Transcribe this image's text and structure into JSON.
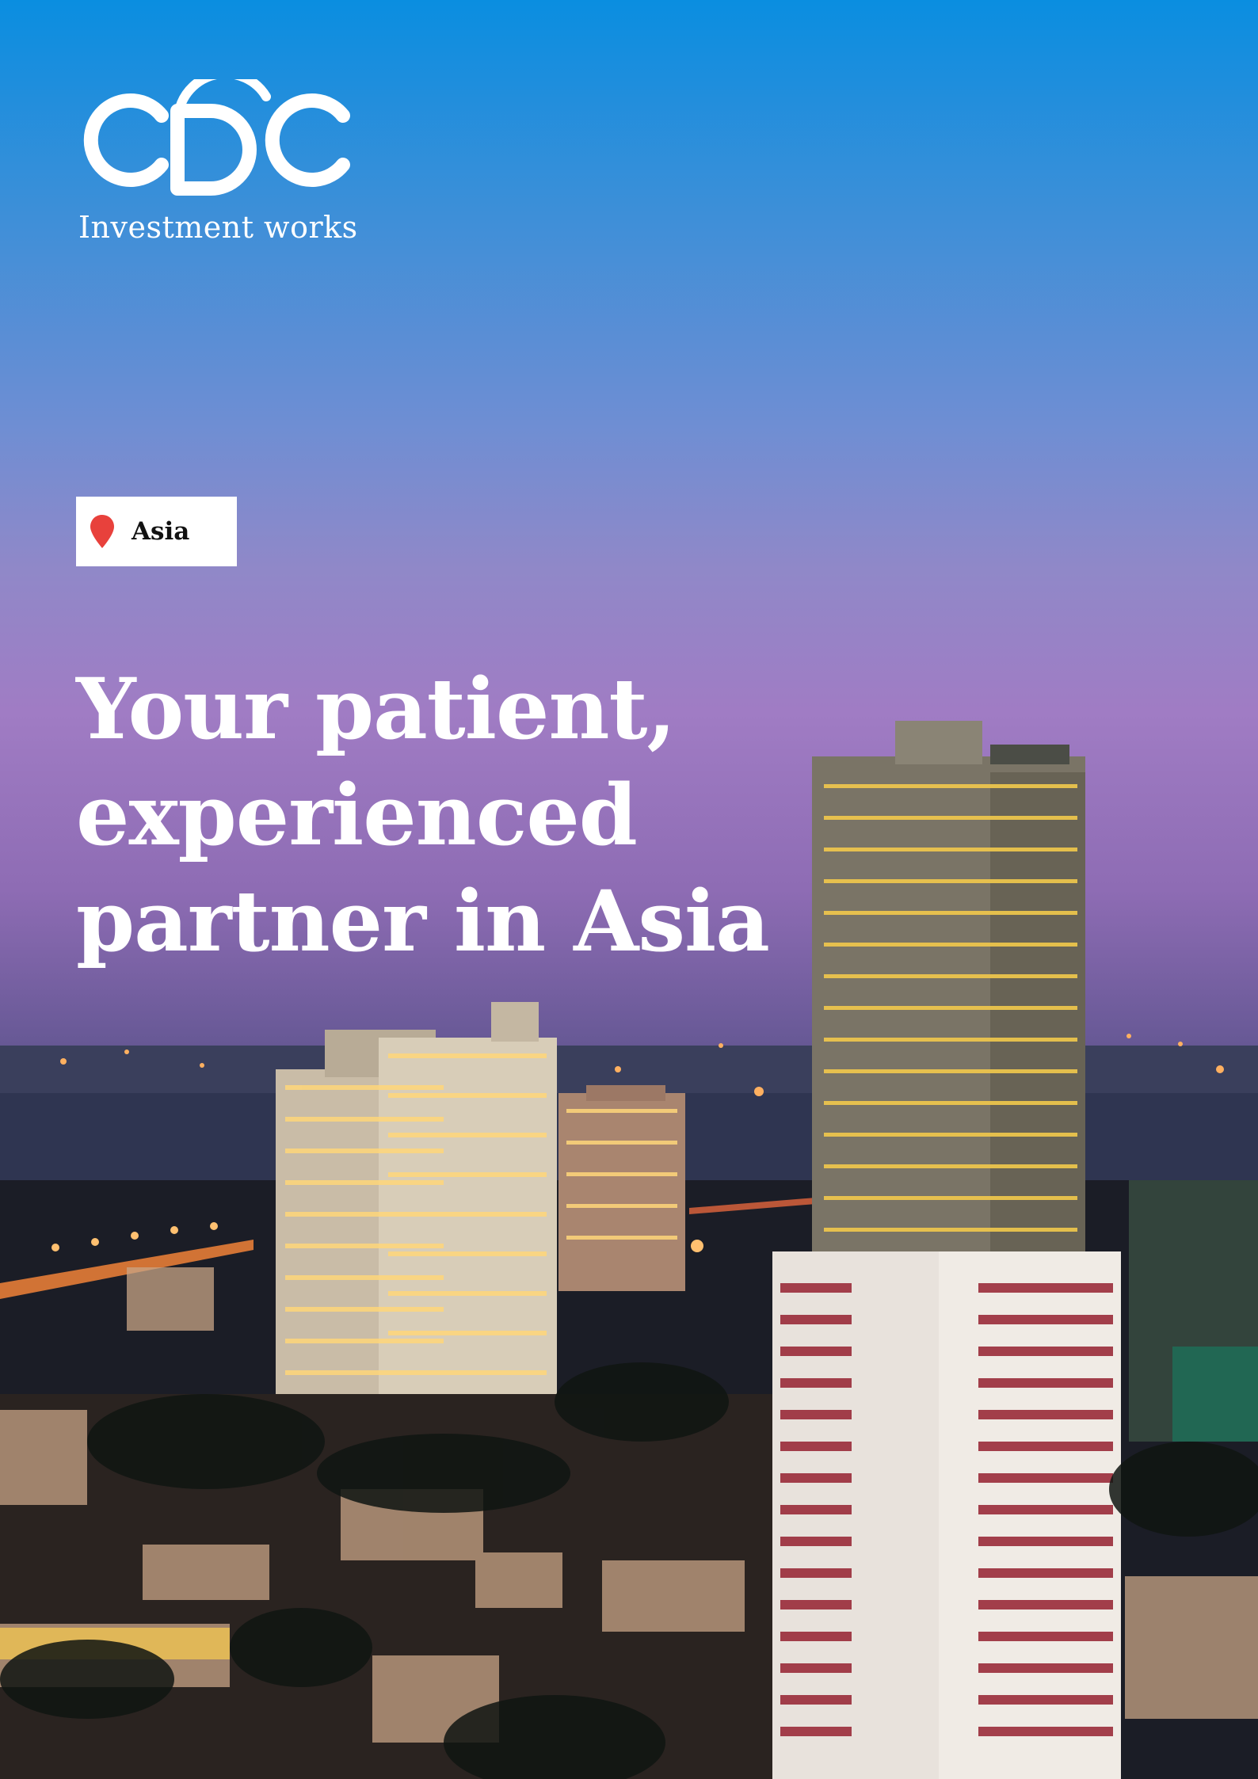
{
  "brand": {
    "logo_text": "CDC",
    "tagline": "Investment works"
  },
  "location_tag": {
    "icon": "map-pin-icon",
    "label": "Asia"
  },
  "headline": {
    "lines": [
      "Your patient,",
      "experienced",
      "partner in Asia"
    ]
  },
  "colors": {
    "pin": "#e8413c",
    "text": "#ffffff",
    "sky_top": "#0a8ee0",
    "sky_mid": "#a07cc4"
  }
}
